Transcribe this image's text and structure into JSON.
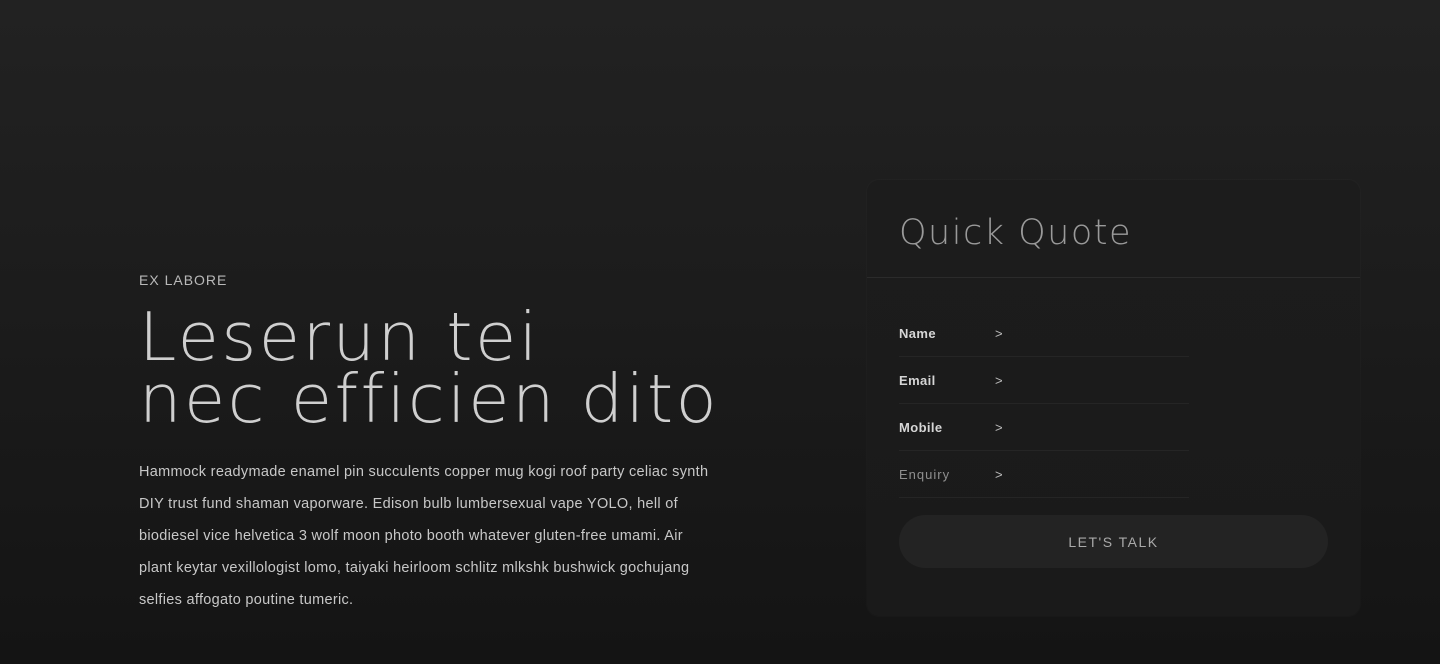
{
  "hero": {
    "eyebrow": "EX LABORE",
    "headline_line1": "Leserun tei",
    "headline_line2": "nec efficien dito",
    "body": "Hammock readymade enamel pin succulents copper mug kogi roof party celiac synth DIY trust fund shaman vaporware. Edison bulb lumbersexual vape YOLO, hell of biodiesel vice helvetica 3 wolf moon photo booth whatever gluten-free umami. Air plant keytar vexillologist lomo, taiyaki heirloom schlitz mlkshk bushwick gochujang selfies affogato poutine tumeric."
  },
  "quote_form": {
    "title": "Quick Quote",
    "fields": [
      {
        "label": "Name",
        "arrow": ">",
        "value": ""
      },
      {
        "label": "Email",
        "arrow": ">",
        "value": ""
      },
      {
        "label": "Mobile",
        "arrow": ">",
        "value": ""
      },
      {
        "label": "Enquiry",
        "arrow": ">",
        "value": ""
      }
    ],
    "submit_label": "LET'S TALK"
  },
  "colors": {
    "background": "#1c1c1c",
    "card": "#1b1b1b",
    "text_primary": "#cfcfcf",
    "text_muted": "#8f8f8f",
    "button": "#232323"
  }
}
